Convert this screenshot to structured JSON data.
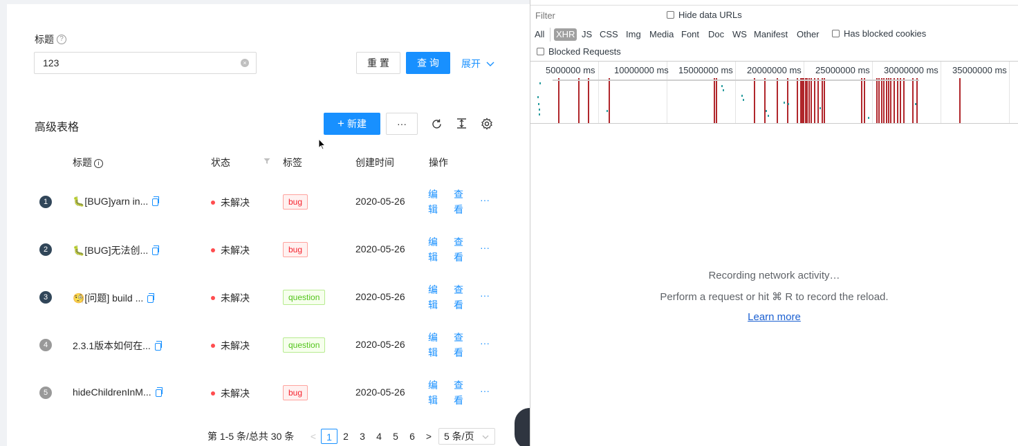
{
  "search_form": {
    "title_label": "标题",
    "help_glyph": "?",
    "title_value": "123",
    "clear_glyph": "×",
    "reset_button": "重 置",
    "query_button": "查 询",
    "expand_link": "展开"
  },
  "table_toolbar": {
    "title": "高级表格",
    "new_button": "新建",
    "more_button": "···"
  },
  "table": {
    "columns": [
      "标题",
      "状态",
      "标签",
      "创建时间",
      "操作"
    ],
    "rows": [
      {
        "index": "1",
        "title": "🐛[BUG]yarn in...",
        "status": "未解决",
        "tag": "bug",
        "created": "2020-05-26",
        "edit": [
          "编",
          "辑"
        ],
        "view": [
          "查",
          "看"
        ],
        "more": "···"
      },
      {
        "index": "2",
        "title": "🐛[BUG]无法创...",
        "status": "未解决",
        "tag": "bug",
        "created": "2020-05-26",
        "edit": [
          "编",
          "辑"
        ],
        "view": [
          "查",
          "看"
        ],
        "more": "···"
      },
      {
        "index": "3",
        "title": "🧐[问题] build ...",
        "status": "未解决",
        "tag": "question",
        "created": "2020-05-26",
        "edit": [
          "编",
          "辑"
        ],
        "view": [
          "查",
          "看"
        ],
        "more": "···"
      },
      {
        "index": "4",
        "title": "2.3.1版本如何在...",
        "status": "未解决",
        "tag": "question",
        "created": "2020-05-26",
        "edit": [
          "编",
          "辑"
        ],
        "view": [
          "查",
          "看"
        ],
        "more": "···"
      },
      {
        "index": "5",
        "title": "hideChildrenInM...",
        "status": "未解决",
        "tag": "bug",
        "created": "2020-05-26",
        "edit": [
          "编",
          "辑"
        ],
        "view": [
          "查",
          "看"
        ],
        "more": "···"
      }
    ]
  },
  "pagination": {
    "summary": "第 1-5 条/总共 30 条",
    "prev": "<",
    "pages": [
      "1",
      "2",
      "3",
      "4",
      "5",
      "6"
    ],
    "current": "1",
    "next": ">",
    "page_size": "5 条/页"
  },
  "devtools": {
    "filter_placeholder": "Filter",
    "hide_data_urls": "Hide data URLs",
    "types": [
      "All",
      "XHR",
      "JS",
      "CSS",
      "Img",
      "Media",
      "Font",
      "Doc",
      "WS",
      "Manifest",
      "Other"
    ],
    "active_type": "XHR",
    "has_blocked_cookies": "Has blocked cookies",
    "blocked_requests": "Blocked Requests",
    "timeline_ticks": [
      "5000000 ms",
      "10000000 ms",
      "15000000 ms",
      "20000000 ms",
      "25000000 ms",
      "30000000 ms",
      "35000000 ms"
    ],
    "empty_line1": "Recording network activity…",
    "empty_line2": "Perform a request or hit ⌘ R to record the reload.",
    "learn_more": "Learn more"
  },
  "colors": {
    "primary": "#1890ff",
    "error": "#ff4d4f",
    "index_dark": "#314659",
    "index_light": "#999999",
    "timeline_bar": "#b0262b"
  }
}
